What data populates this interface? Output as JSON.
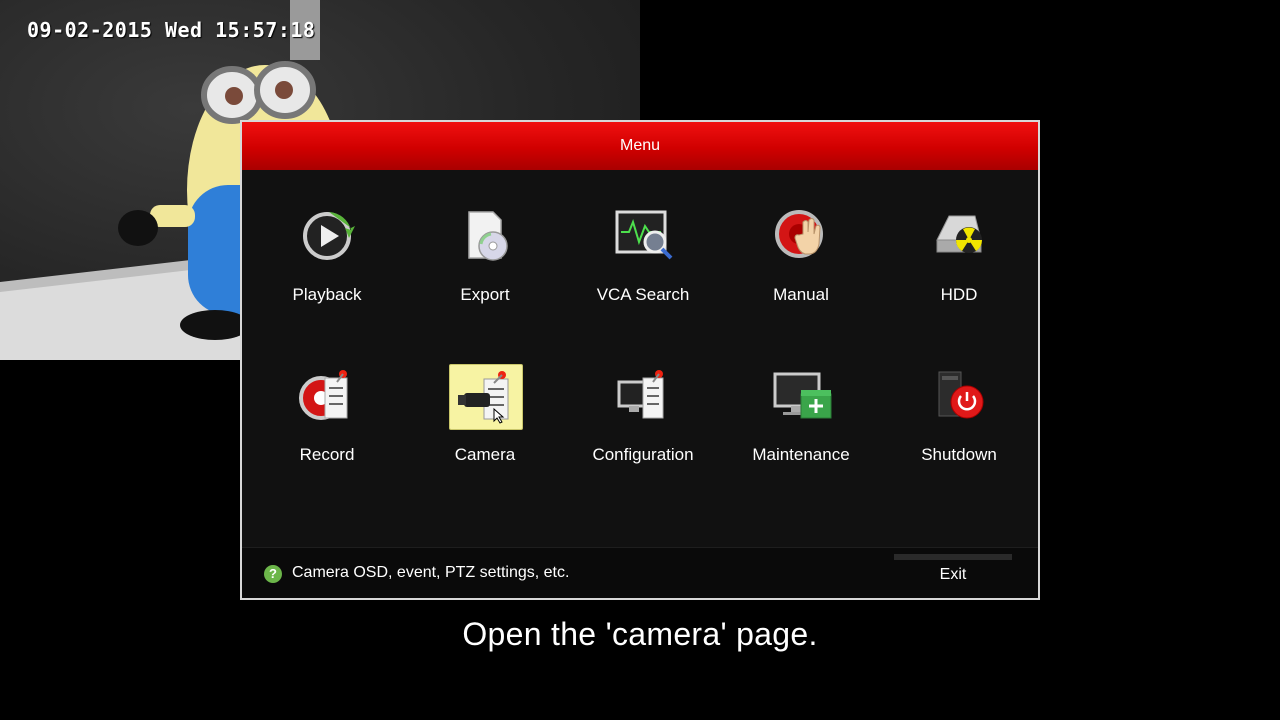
{
  "osd": {
    "timestamp": "09-02-2015 Wed 15:57:18"
  },
  "menu": {
    "title": "Menu",
    "items": [
      {
        "label": "Playback",
        "icon": "playback-icon"
      },
      {
        "label": "Export",
        "icon": "export-icon"
      },
      {
        "label": "VCA Search",
        "icon": "vca-search-icon"
      },
      {
        "label": "Manual",
        "icon": "manual-icon"
      },
      {
        "label": "HDD",
        "icon": "hdd-icon"
      },
      {
        "label": "Record",
        "icon": "record-icon"
      },
      {
        "label": "Camera",
        "icon": "camera-icon",
        "selected": true
      },
      {
        "label": "Configuration",
        "icon": "configuration-icon"
      },
      {
        "label": "Maintenance",
        "icon": "maintenance-icon"
      },
      {
        "label": "Shutdown",
        "icon": "shutdown-icon"
      }
    ],
    "help_text": "Camera OSD, event, PTZ settings, etc.",
    "help_icon": "help-icon",
    "exit_label": "Exit"
  },
  "caption": "Open the 'camera' page.",
  "colors": {
    "header_red": "#e00000",
    "selected_bg": "#f7f3a3",
    "help_green": "#6cb64a"
  }
}
